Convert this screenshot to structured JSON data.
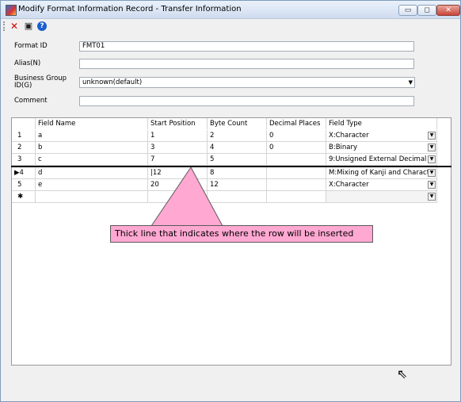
{
  "window": {
    "title": "Modify Format Information Record - Transfer Information",
    "controls": {
      "minimize": "▭",
      "maximize": "◻",
      "close": "✕"
    }
  },
  "toolbar": {
    "icons": [
      "delete-icon",
      "save-icon",
      "help-icon"
    ],
    "delete_glyph": "✕",
    "save_glyph": "▣",
    "help_glyph": "?"
  },
  "form": {
    "format_id": {
      "label": "Format ID",
      "value": "FMT01"
    },
    "alias": {
      "label": "Alias(N)",
      "value": ""
    },
    "business_group": {
      "label_line1": "Business Group",
      "label_line2": "ID(G)",
      "value": "unknown(default)"
    },
    "comment": {
      "label": "Comment",
      "value": ""
    }
  },
  "grid": {
    "columns": [
      "Field Name",
      "Start Position",
      "Byte Count",
      "Decimal Places",
      "Field Type"
    ],
    "rows": [
      {
        "num": "1",
        "name": "a",
        "start": "1",
        "bytes": "2",
        "decimal": "0",
        "type": "X:Character"
      },
      {
        "num": "2",
        "name": "b",
        "start": "3",
        "bytes": "4",
        "decimal": "0",
        "type": "B:Binary"
      },
      {
        "num": "3",
        "name": "c",
        "start": "7",
        "bytes": "5",
        "decimal": "",
        "type": "9:Unsigned External Decimal"
      },
      {
        "num": "▶4",
        "name": "d",
        "start": "|12",
        "bytes": "8",
        "decimal": "",
        "type": "M:Mixing of Kanji and Charact..."
      },
      {
        "num": "5",
        "name": "e",
        "start": "20",
        "bytes": "12",
        "decimal": "",
        "type": "X:Character"
      },
      {
        "num": "✱",
        "name": "",
        "start": "",
        "bytes": "",
        "decimal": "",
        "type": ""
      }
    ]
  },
  "callout": {
    "text": "Thick line that indicates where the row will be inserted",
    "color": "#ffa8d2"
  }
}
